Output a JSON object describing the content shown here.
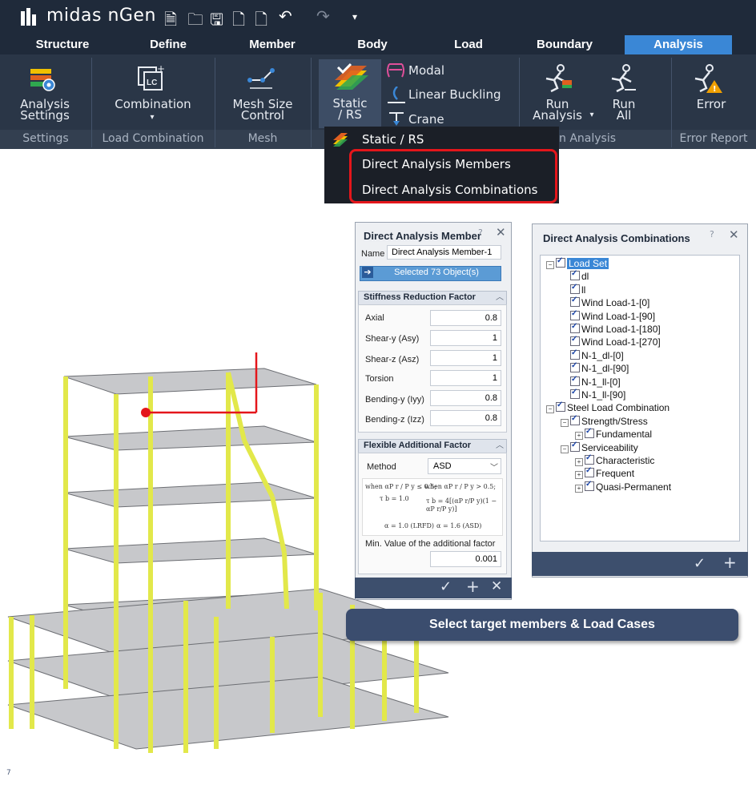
{
  "app": {
    "logo": "midas nGen"
  },
  "tabs": [
    "Structure",
    "Define",
    "Member",
    "Body",
    "Load",
    "Boundary",
    "Analysis"
  ],
  "ribbon": {
    "analysis_settings": "Analysis\nSettings",
    "combination": "Combination",
    "mesh_size_control": "Mesh Size\nControl",
    "static_rs": "Static\n/ RS",
    "modal": "Modal",
    "linear_buckling": "Linear Buckling",
    "crane": "Crane",
    "run_analysis": "Run\nAnalysis",
    "run_all": "Run\nAll",
    "error": "Error",
    "groups": {
      "settings": "Settings",
      "load_combination": "Load Combination",
      "mesh": "Mesh",
      "run_analysis": "n Analysis",
      "error_report": "Error Report"
    }
  },
  "dropdown": {
    "items": [
      "Static / RS",
      "Direct Analysis Members",
      "Direct Analysis Combinations"
    ]
  },
  "member_dialog": {
    "title": "Direct Analysis Member",
    "name_label": "Name",
    "name_value": "Direct Analysis Member-1",
    "selected": "Selected 73 Object(s)",
    "stiffness_header": "Stiffness Reduction Factor",
    "rows": [
      {
        "label": "Axial",
        "value": "0.8"
      },
      {
        "label": "Shear-y (Asy)",
        "value": "1"
      },
      {
        "label": "Shear-z (Asz)",
        "value": "1"
      },
      {
        "label": "Torsion",
        "value": "1"
      },
      {
        "label": "Bending-y (Iyy)",
        "value": "0.8"
      },
      {
        "label": "Bending-z (Izz)",
        "value": "0.8"
      }
    ],
    "flex_header": "Flexible Additional Factor",
    "method_label": "Method",
    "method_value": "ASD",
    "formula_left_cond": "when αP r / P y ≤ 0.5;",
    "formula_left_val": "τ b = 1.0",
    "formula_right_cond": "when αP r / P y > 0.5;",
    "formula_right_val": "τ b = 4[(αP r/P y)(1 − αP r/P y)]",
    "alpha_lrfd": "α = 1.0  (LRFD)",
    "alpha_asd": "α = 1.6 (ASD)",
    "min_label": "Min. Value of the additional factor",
    "min_value": "0.001"
  },
  "comb_dialog": {
    "title": "Direct Analysis Combinations",
    "tree": [
      {
        "label": "Load Set",
        "level": 0,
        "pm": "−"
      },
      {
        "label": "dl",
        "level": 1
      },
      {
        "label": "ll",
        "level": 1
      },
      {
        "label": "Wind Load-1-[0]",
        "level": 1
      },
      {
        "label": "Wind Load-1-[90]",
        "level": 1
      },
      {
        "label": "Wind Load-1-[180]",
        "level": 1
      },
      {
        "label": "Wind Load-1-[270]",
        "level": 1
      },
      {
        "label": "N-1_dl-[0]",
        "level": 1
      },
      {
        "label": "N-1_dl-[90]",
        "level": 1
      },
      {
        "label": "N-1_ll-[0]",
        "level": 1
      },
      {
        "label": "N-1_ll-[90]",
        "level": 1
      },
      {
        "label": "Steel Load Combination",
        "level": 0,
        "pm": "−"
      },
      {
        "label": "Strength/Stress",
        "level": 1,
        "pm": "−"
      },
      {
        "label": "Fundamental",
        "level": 2,
        "pm": "+"
      },
      {
        "label": "Serviceability",
        "level": 1,
        "pm": "−"
      },
      {
        "label": "Characteristic",
        "level": 2,
        "pm": "+"
      },
      {
        "label": "Frequent",
        "level": 2,
        "pm": "+"
      },
      {
        "label": "Quasi-Permanent",
        "level": 2,
        "pm": "+"
      }
    ]
  },
  "callout": "Select target members & Load Cases",
  "page_number": "7",
  "colors": {
    "ribbon_bg": "#2a3647",
    "active_tab": "#3a87d6",
    "highlight": "#e4161b",
    "callout": "#3b4d6e",
    "members": "#e2e84a"
  }
}
